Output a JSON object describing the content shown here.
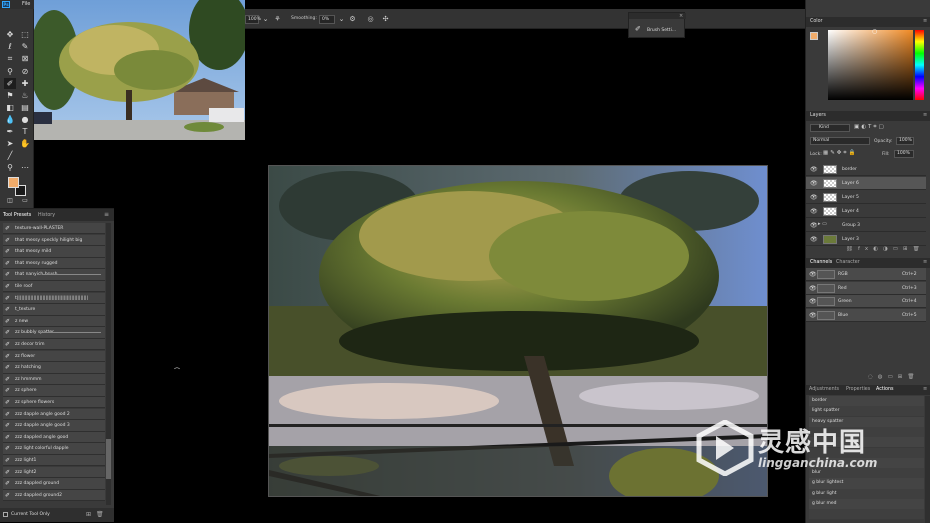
{
  "menubar": {
    "logo": "Ps",
    "file_menu": "File"
  },
  "options_bar": {
    "zoom_value": "100%",
    "smoothing_label": "Smoothing:",
    "smoothing_value": "0%"
  },
  "brush_settings": {
    "label": "Brush Setti..."
  },
  "toolbar": {
    "foreground_color": "#f0ab6a",
    "background_color": "#1a1a1a"
  },
  "tool_presets": {
    "tabs": [
      "Tool Presets",
      "History"
    ],
    "items": [
      "texture-wall-PLASTER",
      "that messy speckly hilight big",
      "that messy mild",
      "that messy rugged",
      "that nanyich brush",
      "tile roof",
      "t|||||||||||||||||||||||||||||||||||||||||||||||",
      "t_texture",
      "z new",
      "zz bubbly spatter",
      "zz decor trim",
      "zz flower",
      "zz hatching",
      "zz hmmmm",
      "zz sphere",
      "zz sphere flowers",
      "zzz dapple angle good 2",
      "zzz dapple angle good 3",
      "zzz dappled angle good",
      "zzz light colorful dapple",
      "zzz light1",
      "zzz light2",
      "zzz dappled ground",
      "zzz dappled ground2"
    ],
    "footer_checkbox_label": "Current Tool Only"
  },
  "color_panel": {
    "title": "Color",
    "fg": "#f0ab6a"
  },
  "layers_panel": {
    "title": "Layers",
    "kind_label": "Kind",
    "blend_mode": "Normal",
    "opacity_label": "Opacity:",
    "opacity_value": "100%",
    "lock_label": "Lock:",
    "fill_label": "Fill:",
    "fill_value": "100%",
    "layers": [
      "border",
      "Layer 6",
      "Layer 5",
      "Layer 4",
      "Group 3",
      "Layer 3"
    ]
  },
  "channels_panel": {
    "tabs": [
      "Channels",
      "Character"
    ],
    "channels": [
      {
        "name": "RGB",
        "key": "Ctrl+2"
      },
      {
        "name": "Red",
        "key": "Ctrl+3"
      },
      {
        "name": "Green",
        "key": "Ctrl+4"
      },
      {
        "name": "Blue",
        "key": "Ctrl+5"
      }
    ]
  },
  "actions_panel": {
    "tabs": [
      "Adjustments",
      "Properties",
      "Actions"
    ],
    "actions": [
      "border",
      "light spatter",
      "heavy spatter",
      "",
      "",
      "",
      "",
      "blur",
      "g blur lightest",
      "g blur light",
      "g blur med",
      ""
    ]
  },
  "watermark": {
    "cn": "灵感中国",
    "en": "lingganchina.com"
  }
}
